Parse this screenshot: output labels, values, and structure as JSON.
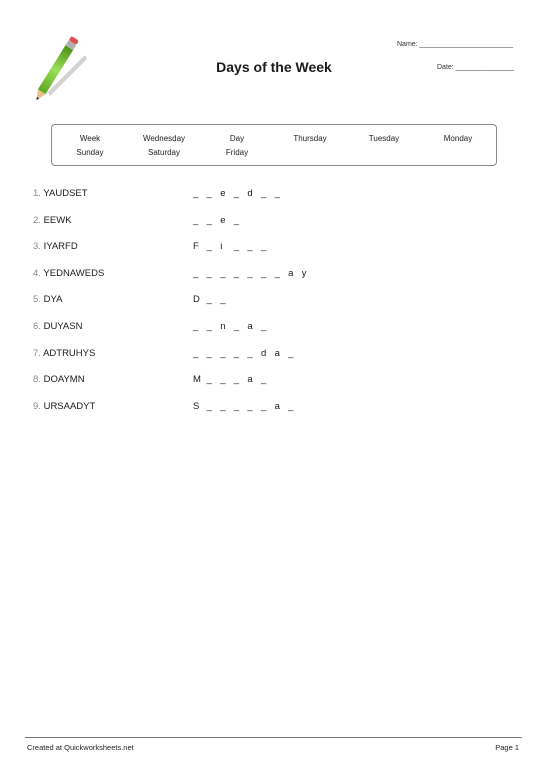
{
  "header": {
    "title": "Days of the Week",
    "name_label": "Name: ________________________",
    "date_label": "Date: _______________",
    "logo_icon": "pencil-icon"
  },
  "word_bank": {
    "rows": [
      [
        "Week",
        "Wednesday",
        "Day",
        "Thursday",
        "Tuesday",
        "Monday"
      ],
      [
        "Sunday",
        "Saturday",
        "Friday"
      ]
    ]
  },
  "questions": [
    {
      "number": "1.",
      "scrambled": "YAUDSET",
      "hint": [
        "_",
        "_",
        "e",
        "_",
        "d",
        "_",
        "_"
      ]
    },
    {
      "number": "2.",
      "scrambled": "EEWK",
      "hint": [
        "_",
        "_",
        "e",
        "_"
      ]
    },
    {
      "number": "3.",
      "scrambled": "IYARFD",
      "hint": [
        "F",
        "_",
        "i",
        "_",
        "_",
        "_"
      ]
    },
    {
      "number": "4.",
      "scrambled": "YEDNAWEDS",
      "hint": [
        "_",
        "_",
        "_",
        "_",
        "_",
        "_",
        "_",
        "a",
        "y"
      ]
    },
    {
      "number": "5.",
      "scrambled": "DYA",
      "hint": [
        "D",
        "_",
        "_"
      ]
    },
    {
      "number": "6.",
      "scrambled": "DUYASN",
      "hint": [
        "_",
        "_",
        "n",
        "_",
        "a",
        "_"
      ]
    },
    {
      "number": "7.",
      "scrambled": "ADTRUHYS",
      "hint": [
        "_",
        "_",
        "_",
        "_",
        "_",
        "d",
        "a",
        "_"
      ]
    },
    {
      "number": "8.",
      "scrambled": "DOAYMN",
      "hint": [
        "M",
        "_",
        "_",
        "_",
        "a",
        "_"
      ]
    },
    {
      "number": "9.",
      "scrambled": "URSAADYT",
      "hint": [
        "S",
        "_",
        "_",
        "_",
        "_",
        "_",
        "a",
        "_"
      ]
    }
  ],
  "footer": {
    "credit": "Created at Quickworksheets.net",
    "page": "Page 1"
  }
}
